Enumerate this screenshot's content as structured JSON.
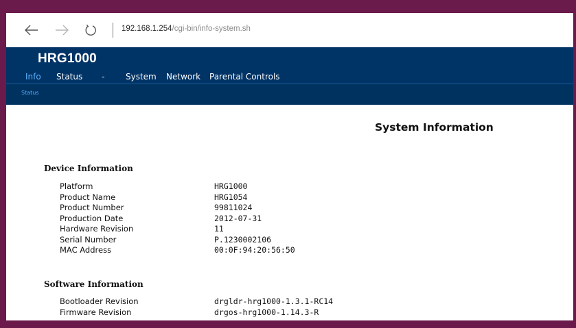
{
  "browser": {
    "address_host": "192.168.1.254",
    "address_path": "/cgi-bin/info-system.sh"
  },
  "router": {
    "brand": "HRG1000",
    "menu": [
      {
        "label": "Info",
        "active": true
      },
      {
        "label": "Status",
        "active": false
      },
      {
        "label": "-",
        "active": false
      },
      {
        "label": "System",
        "active": false
      },
      {
        "label": "Network",
        "active": false
      },
      {
        "label": "Parental Controls",
        "active": false
      }
    ],
    "subnav": "Status"
  },
  "page": {
    "title": "System Information",
    "device": {
      "heading": "Device Information",
      "rows": [
        {
          "label": "Platform",
          "value": "HRG1000"
        },
        {
          "label": "Product Name",
          "value": "HRG1054"
        },
        {
          "label": "Product Number",
          "value": "99811024"
        },
        {
          "label": "Production Date",
          "value": "2012-07-31"
        },
        {
          "label": "Hardware Revision",
          "value": "11"
        },
        {
          "label": "Serial Number",
          "value": "P.1230002106"
        },
        {
          "label": "MAC Address",
          "value": "00:0F:94:20:56:50"
        }
      ]
    },
    "software": {
      "heading": "Software Information",
      "rows": [
        {
          "label": "Bootloader Revision",
          "value": "drgldr-hrg1000-1.3.1-RC14"
        },
        {
          "label": "Firmware Revision",
          "value": "drgos-hrg1000-1.14.3-R"
        }
      ]
    }
  },
  "colors": {
    "frame": "#6b1a4c",
    "header": "#003366",
    "active_menu": "#5fb5ff"
  }
}
